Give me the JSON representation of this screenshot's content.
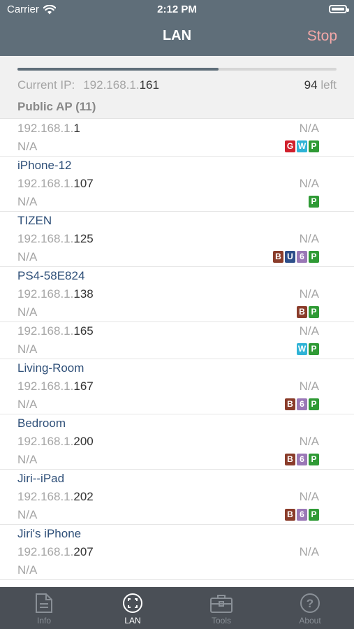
{
  "status_bar": {
    "carrier": "Carrier",
    "time": "2:12 PM"
  },
  "nav": {
    "title": "LAN",
    "stop_label": "Stop"
  },
  "scan": {
    "progress": 0.63,
    "current_ip_label": "Current IP:",
    "current_ip_prefix": "192.168.1.",
    "current_ip_last": "161",
    "remaining_count": "94",
    "remaining_label": "left"
  },
  "section": {
    "title": "Public AP (11)"
  },
  "badge_colors": {
    "G": "#d0202c",
    "W": "#2fb3d6",
    "P": "#2f9a35",
    "B": "#8a3c2a",
    "U": "#2e4f8a",
    "6": "#9a78b6"
  },
  "devices": [
    {
      "name": "",
      "ip_prefix": "192.168.1.",
      "ip_last": "1",
      "vendor": "N/A",
      "mac": "N/A",
      "badges": [
        "G",
        "W",
        "P"
      ]
    },
    {
      "name": "iPhone-12",
      "ip_prefix": "192.168.1.",
      "ip_last": "107",
      "vendor": "N/A",
      "mac": "N/A",
      "badges": [
        "P"
      ]
    },
    {
      "name": "TIZEN",
      "ip_prefix": "192.168.1.",
      "ip_last": "125",
      "vendor": "N/A",
      "mac": "N/A",
      "badges": [
        "B",
        "U",
        "6",
        "P"
      ]
    },
    {
      "name": "PS4-58E824",
      "ip_prefix": "192.168.1.",
      "ip_last": "138",
      "vendor": "N/A",
      "mac": "N/A",
      "badges": [
        "B",
        "P"
      ]
    },
    {
      "name": "",
      "ip_prefix": "192.168.1.",
      "ip_last": "165",
      "vendor": "N/A",
      "mac": "N/A",
      "badges": [
        "W",
        "P"
      ]
    },
    {
      "name": "Living-Room",
      "ip_prefix": "192.168.1.",
      "ip_last": "167",
      "vendor": "N/A",
      "mac": "N/A",
      "badges": [
        "B",
        "6",
        "P"
      ]
    },
    {
      "name": "Bedroom",
      "ip_prefix": "192.168.1.",
      "ip_last": "200",
      "vendor": "N/A",
      "mac": "N/A",
      "badges": [
        "B",
        "6",
        "P"
      ]
    },
    {
      "name": "Jiri--iPad",
      "ip_prefix": "192.168.1.",
      "ip_last": "202",
      "vendor": "N/A",
      "mac": "N/A",
      "badges": [
        "B",
        "6",
        "P"
      ]
    },
    {
      "name": "Jiri's iPhone",
      "ip_prefix": "192.168.1.",
      "ip_last": "207",
      "vendor": "N/A",
      "mac": "N/A",
      "badges": []
    }
  ],
  "tabs": [
    {
      "label": "Info",
      "icon": "document-icon",
      "active": false
    },
    {
      "label": "LAN",
      "icon": "scan-icon",
      "active": true
    },
    {
      "label": "Tools",
      "icon": "toolbox-icon",
      "active": false
    },
    {
      "label": "About",
      "icon": "question-icon",
      "active": false
    }
  ]
}
